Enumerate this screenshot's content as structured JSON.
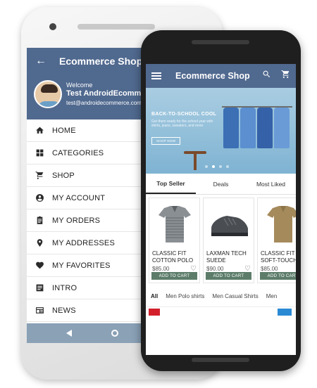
{
  "back_screen": {
    "app_title": "Ecommerce Shop",
    "profile": {
      "welcome": "Welcome",
      "name": "Test AndroidEcommerce",
      "email": "test@androidecommerce.com"
    },
    "menu": [
      {
        "label": "HOME",
        "icon": "home-icon"
      },
      {
        "label": "CATEGORIES",
        "icon": "grid-icon"
      },
      {
        "label": "SHOP",
        "icon": "cart-icon"
      },
      {
        "label": "MY ACCOUNT",
        "icon": "account-icon"
      },
      {
        "label": "MY ORDERS",
        "icon": "clipboard-icon"
      },
      {
        "label": "MY ADDRESSES",
        "icon": "location-pin-icon"
      },
      {
        "label": "MY FAVORITES",
        "icon": "heart-icon"
      },
      {
        "label": "INTRO",
        "icon": "list-icon"
      },
      {
        "label": "NEWS",
        "icon": "news-icon"
      }
    ]
  },
  "front_screen": {
    "app_title": "Ecommerce Shop",
    "banner": {
      "title": "BACK-TO-SCHOOL COOL",
      "subtitle": "Get them ready for the school year with shirts, jeans, sweaters, and more",
      "button": "SHOP NOW",
      "active_dot": 2,
      "dot_count": 4
    },
    "tabs": [
      "Top Seller",
      "Deals",
      "Most Liked"
    ],
    "active_tab": 0,
    "products": [
      {
        "name": "CLASSIC FIT COTTON POLO",
        "price": "$85.00",
        "cta": "ADD TO CART",
        "color": "#8a8f94"
      },
      {
        "name": "LAXMAN TECH SUEDE",
        "price": "$90.00",
        "cta": "ADD TO CART",
        "color": "#4a4d52"
      },
      {
        "name": "CLASSIC FIT SOFT-TOUCH",
        "price": "$85.00",
        "cta": "ADD TO CART",
        "color": "#a58a5c"
      }
    ],
    "category_tabs": [
      "All",
      "Men Polo shirts",
      "Men Casual Shirts",
      "Men"
    ],
    "active_category": 0
  },
  "colors": {
    "app_bar": "#50698f",
    "add_to_cart": "#5d7d6a"
  }
}
